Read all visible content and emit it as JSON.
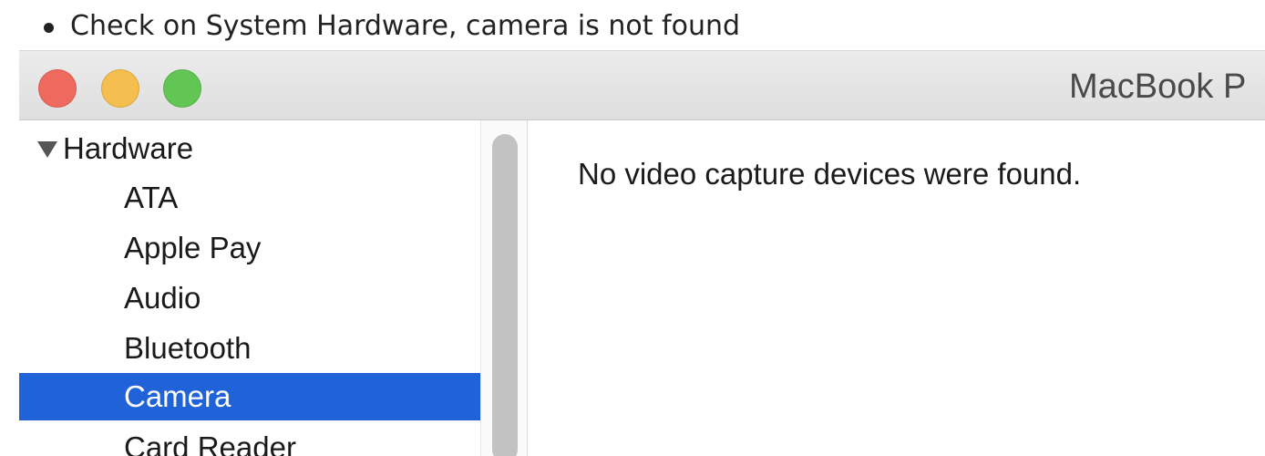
{
  "note": {
    "text": "Check on System Hardware, camera is not found"
  },
  "window": {
    "title": "MacBook P",
    "traffic_lights": {
      "close_color": "#ee6a5e",
      "minimize_color": "#f5bf4f",
      "zoom_color": "#62c655"
    }
  },
  "sidebar": {
    "group_label": "Hardware",
    "items": [
      {
        "label": "ATA"
      },
      {
        "label": "Apple Pay"
      },
      {
        "label": "Audio"
      },
      {
        "label": "Bluetooth"
      },
      {
        "label": "Camera",
        "selected": true
      },
      {
        "label": "Card Reader"
      }
    ],
    "selection_color": "#2062d8"
  },
  "content": {
    "message": "No video capture devices were found."
  }
}
